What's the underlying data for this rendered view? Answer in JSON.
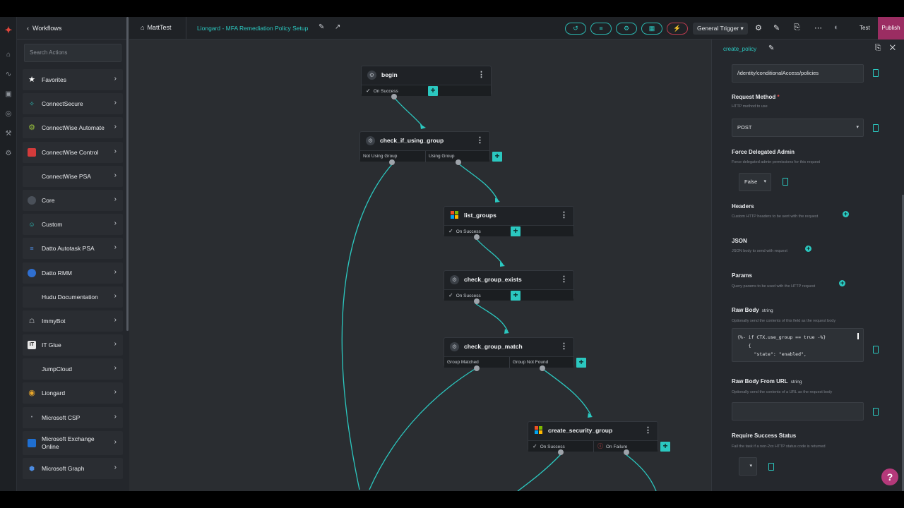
{
  "sidebar": {
    "back_label": "Workflows",
    "search_placeholder": "Search Actions",
    "items": [
      {
        "label": "Favorites",
        "icon": "star-icon"
      },
      {
        "label": "ConnectSecure",
        "icon": "connectsecure-icon"
      },
      {
        "label": "ConnectWise Automate",
        "icon": "gear-icon"
      },
      {
        "label": "ConnectWise Control",
        "icon": "control-icon"
      },
      {
        "label": "ConnectWise PSA",
        "icon": "psa-icon"
      },
      {
        "label": "Core",
        "icon": "core-icon"
      },
      {
        "label": "Custom",
        "icon": "users-icon"
      },
      {
        "label": "Datto Autotask PSA",
        "icon": "autotask-icon"
      },
      {
        "label": "Datto RMM",
        "icon": "datto-icon"
      },
      {
        "label": "Hudu Documentation",
        "icon": "hudu-icon"
      },
      {
        "label": "ImmyBot",
        "icon": "immybot-icon"
      },
      {
        "label": "IT Glue",
        "icon": "itglue-icon"
      },
      {
        "label": "JumpCloud",
        "icon": "jumpcloud-icon"
      },
      {
        "label": "Liongard",
        "icon": "liongard-icon"
      },
      {
        "label": "Microsoft CSP",
        "icon": "microsoft-icon"
      },
      {
        "label": "Microsoft Exchange Online",
        "icon": "exchange-icon"
      },
      {
        "label": "Microsoft Graph",
        "icon": "graph-icon"
      }
    ]
  },
  "header": {
    "home_label": "MattTest",
    "workflow_title": "Liongard - MFA Remediation Policy Setup",
    "trigger_label": "General Trigger",
    "test_label": "Test",
    "publish_label": "Publish"
  },
  "nodes": [
    {
      "title": "begin",
      "ports": [
        "On Success"
      ]
    },
    {
      "title": "check_if_using_group",
      "ports": [
        "Not Using Group",
        "Using Group"
      ]
    },
    {
      "title": "list_groups",
      "ports": [
        "On Success"
      ]
    },
    {
      "title": "check_group_exists",
      "ports": [
        "On Success"
      ]
    },
    {
      "title": "check_group_match",
      "ports": [
        "Group Matched",
        "Group Not Found"
      ]
    },
    {
      "title": "create_security_group",
      "ports": [
        "On Success",
        "On Failure"
      ]
    }
  ],
  "panel": {
    "title": "create_policy",
    "url_value": "/identity/conditionalAccess/policies",
    "request_method_label": "Request Method",
    "request_method_help": "HTTP method to use",
    "request_method_value": "POST",
    "force_label": "Force Delegated Admin",
    "force_help": "Force delegated admin permissions for this request",
    "force_value": "False",
    "headers_label": "Headers",
    "headers_help": "Custom HTTP headers to be sent with the request",
    "json_label": "JSON",
    "json_help": "JSON body to send with request",
    "params_label": "Params",
    "params_help": "Query params to be used with the HTTP request",
    "raw_body_label": "Raw Body",
    "raw_body_tag": "string",
    "raw_body_help": "Optionally send the contents of this field as the request body",
    "raw_body_code": "{%- if CTX.use_group == true -%}\n    {\n      \"state\": \"enabled\",",
    "raw_url_label": "Raw Body From URL",
    "raw_url_tag": "string",
    "raw_url_help": "Optionally send the contents of a URL as the request body",
    "success_label": "Require Success Status",
    "success_help": "Fail the task if a non-2xx HTTP status code is returned"
  },
  "colors": {
    "accent": "#2bc8c0",
    "publish": "#9b2d62",
    "failure": "#e04a4a"
  }
}
